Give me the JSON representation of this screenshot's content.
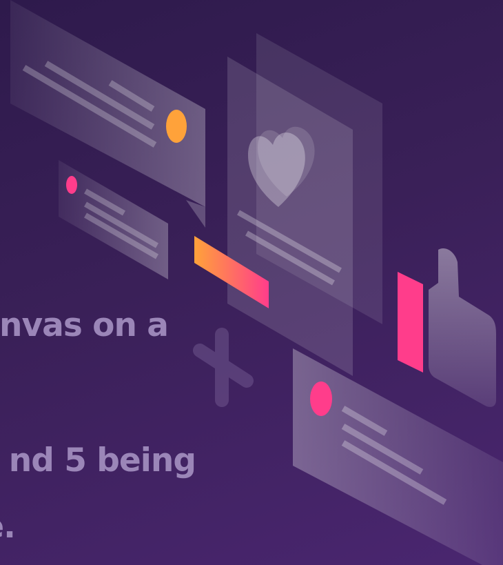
{
  "question": {
    "lines": [
      "nvas on a",
      "nd 5 being",
      "e."
    ]
  },
  "illustration": {
    "accent_pink": "#ff3d8b",
    "accent_orange": "#ffa23a",
    "icons": [
      "heart-icon",
      "thumbs-up-icon",
      "plus-icon"
    ]
  }
}
